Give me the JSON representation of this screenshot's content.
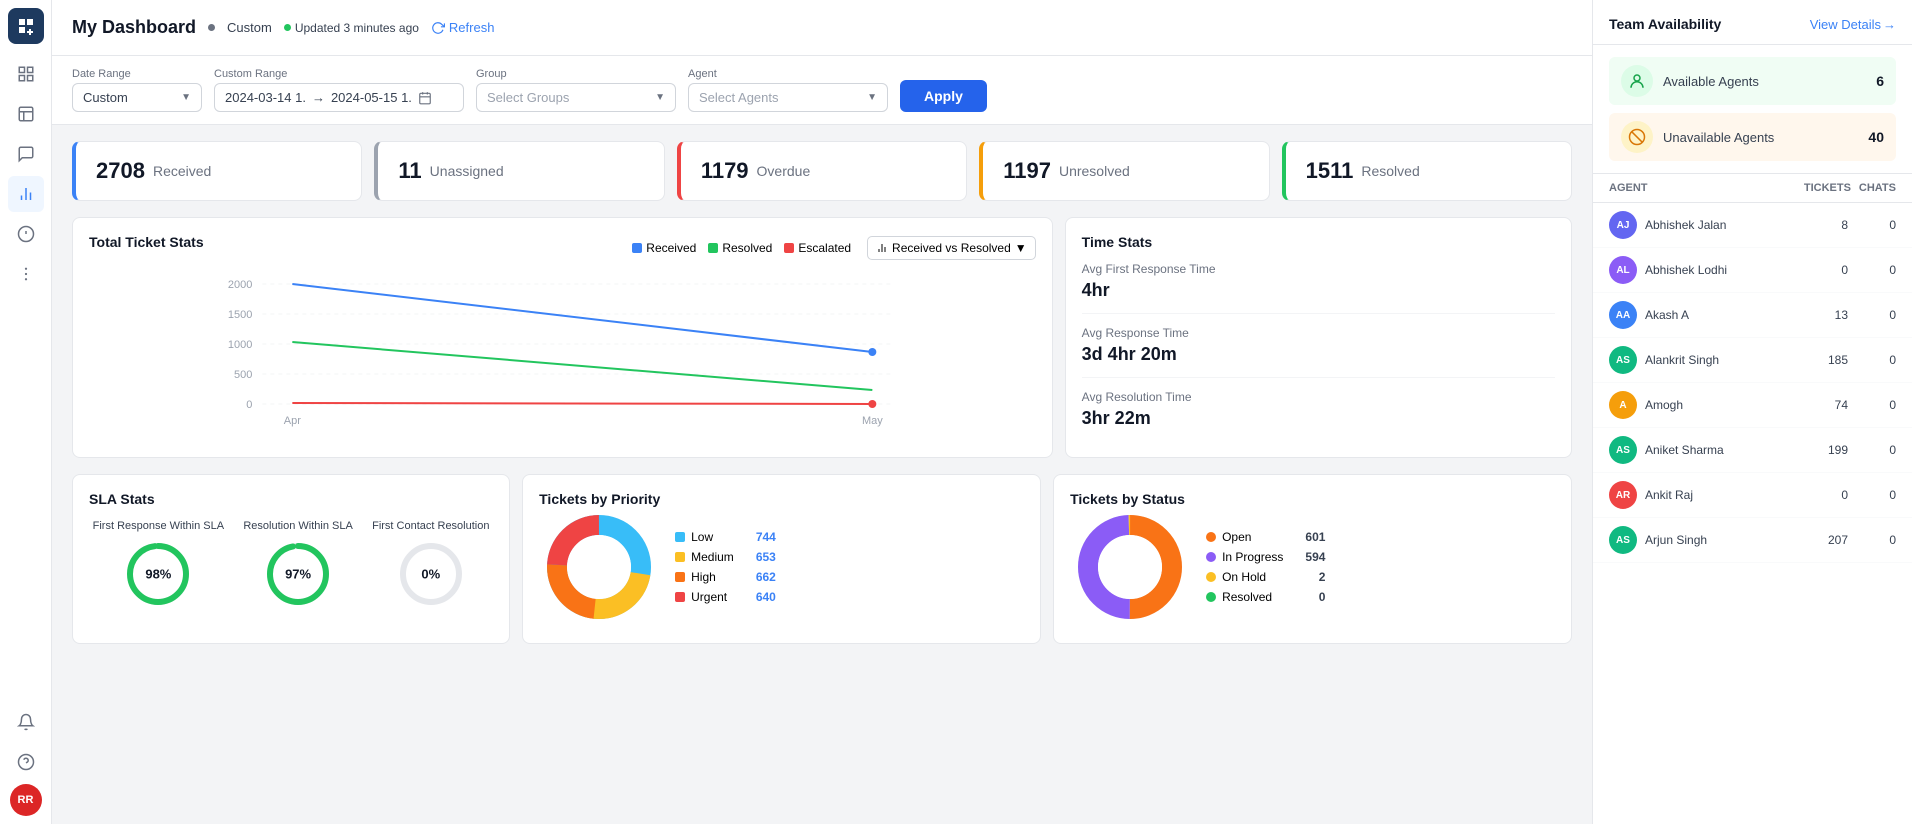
{
  "app": {
    "title": "My Dashboard",
    "custom_label": "Custom",
    "updated_text": "Updated 3 minutes ago",
    "refresh_label": "Refresh"
  },
  "filters": {
    "date_range_label": "Date Range",
    "date_range_value": "Custom",
    "custom_range_label": "Custom Range",
    "custom_range_start": "2024-03-14 1.",
    "custom_range_end": "2024-05-15 1.",
    "group_label": "Group",
    "group_placeholder": "Select Groups",
    "agent_label": "Agent",
    "agent_placeholder": "Select Agents",
    "apply_label": "Apply"
  },
  "stats": [
    {
      "number": "2708",
      "label": "Received",
      "border_color": "blue"
    },
    {
      "number": "11",
      "label": "Unassigned",
      "border_color": "gray"
    },
    {
      "number": "1179",
      "label": "Overdue",
      "border_color": "red"
    },
    {
      "number": "1197",
      "label": "Unresolved",
      "border_color": "yellow"
    },
    {
      "number": "1511",
      "label": "Resolved",
      "border_color": "green"
    }
  ],
  "total_ticket_stats": {
    "title": "Total Ticket Stats",
    "legend": [
      {
        "label": "Received",
        "color": "#3b82f6"
      },
      {
        "label": "Resolved",
        "color": "#22c55e"
      },
      {
        "label": "Escalated",
        "color": "#ef4444"
      }
    ],
    "dropdown_label": "Received vs Resolved",
    "x_labels": [
      "Apr",
      "May"
    ],
    "y_labels": [
      "2000",
      "1500",
      "1000",
      "500",
      "0"
    ],
    "chart_data": {
      "received_start": 2000,
      "received_end": 950,
      "resolved_start": 1020,
      "resolved_end": 320,
      "escalated_start": 20,
      "escalated_end": 18
    }
  },
  "time_stats": {
    "title": "Time Stats",
    "items": [
      {
        "label": "Avg First Response Time",
        "value": "4hr"
      },
      {
        "label": "Avg Response Time",
        "value": "3d 4hr 20m"
      },
      {
        "label": "Avg Resolution Time",
        "value": "3hr 22m"
      }
    ]
  },
  "sla_stats": {
    "title": "SLA Stats",
    "metrics": [
      {
        "label": "First Response Within SLA",
        "value": "98%",
        "percentage": 98,
        "color": "#22c55e"
      },
      {
        "label": "Resolution Within SLA",
        "value": "97%",
        "percentage": 97,
        "color": "#22c55e"
      },
      {
        "label": "First Contact Resolution",
        "value": "0%",
        "percentage": 0,
        "color": "#22c55e"
      }
    ]
  },
  "tickets_by_priority": {
    "title": "Tickets by Priority",
    "items": [
      {
        "label": "Low",
        "value": "744",
        "color": "#38bdf8"
      },
      {
        "label": "Medium",
        "value": "653",
        "color": "#fbbf24"
      },
      {
        "label": "High",
        "value": "662",
        "color": "#f97316"
      },
      {
        "label": "Urgent",
        "value": "640",
        "color": "#ef4444"
      }
    ]
  },
  "tickets_by_status": {
    "title": "Tickets by Status",
    "items": [
      {
        "label": "Open",
        "value": "601",
        "color": "#f97316"
      },
      {
        "label": "In Progress",
        "value": "594",
        "color": "#8b5cf6"
      },
      {
        "label": "On Hold",
        "value": "2",
        "color": "#fbbf24"
      },
      {
        "label": "Resolved",
        "value": "0",
        "color": "#22c55e"
      }
    ]
  },
  "team_availability": {
    "title": "Team Availability",
    "view_details": "View Details",
    "available": {
      "label": "Available Agents",
      "count": "6"
    },
    "unavailable": {
      "label": "Unavailable Agents",
      "count": "40"
    },
    "columns": [
      "Agent",
      "Tickets",
      "Chats"
    ],
    "agents": [
      {
        "initials": "AJ",
        "name": "Abhishek Jalan",
        "tickets": "8",
        "chats": "0",
        "color": "#6366f1"
      },
      {
        "initials": "AL",
        "name": "Abhishek Lodhi",
        "tickets": "0",
        "chats": "0",
        "color": "#8b5cf6"
      },
      {
        "initials": "AA",
        "name": "Akash A",
        "tickets": "13",
        "chats": "0",
        "color": "#3b82f6"
      },
      {
        "initials": "AS",
        "name": "Alankrit Singh",
        "tickets": "185",
        "chats": "0",
        "color": "#10b981"
      },
      {
        "initials": "A",
        "name": "Amogh",
        "tickets": "74",
        "chats": "0",
        "color": "#f59e0b"
      },
      {
        "initials": "AS",
        "name": "Aniket Sharma",
        "tickets": "199",
        "chats": "0",
        "color": "#10b981"
      },
      {
        "initials": "AR",
        "name": "Ankit Raj",
        "tickets": "0",
        "chats": "0",
        "color": "#ef4444"
      },
      {
        "initials": "AS",
        "name": "Arjun Singh",
        "tickets": "207",
        "chats": "0",
        "color": "#10b981"
      }
    ]
  },
  "sidebar": {
    "icons": [
      "grid",
      "layout",
      "chat",
      "bar-chart",
      "dashboard",
      "ticket",
      "more"
    ],
    "bottom_icons": [
      "bell",
      "help"
    ],
    "user_initials": "RR"
  }
}
